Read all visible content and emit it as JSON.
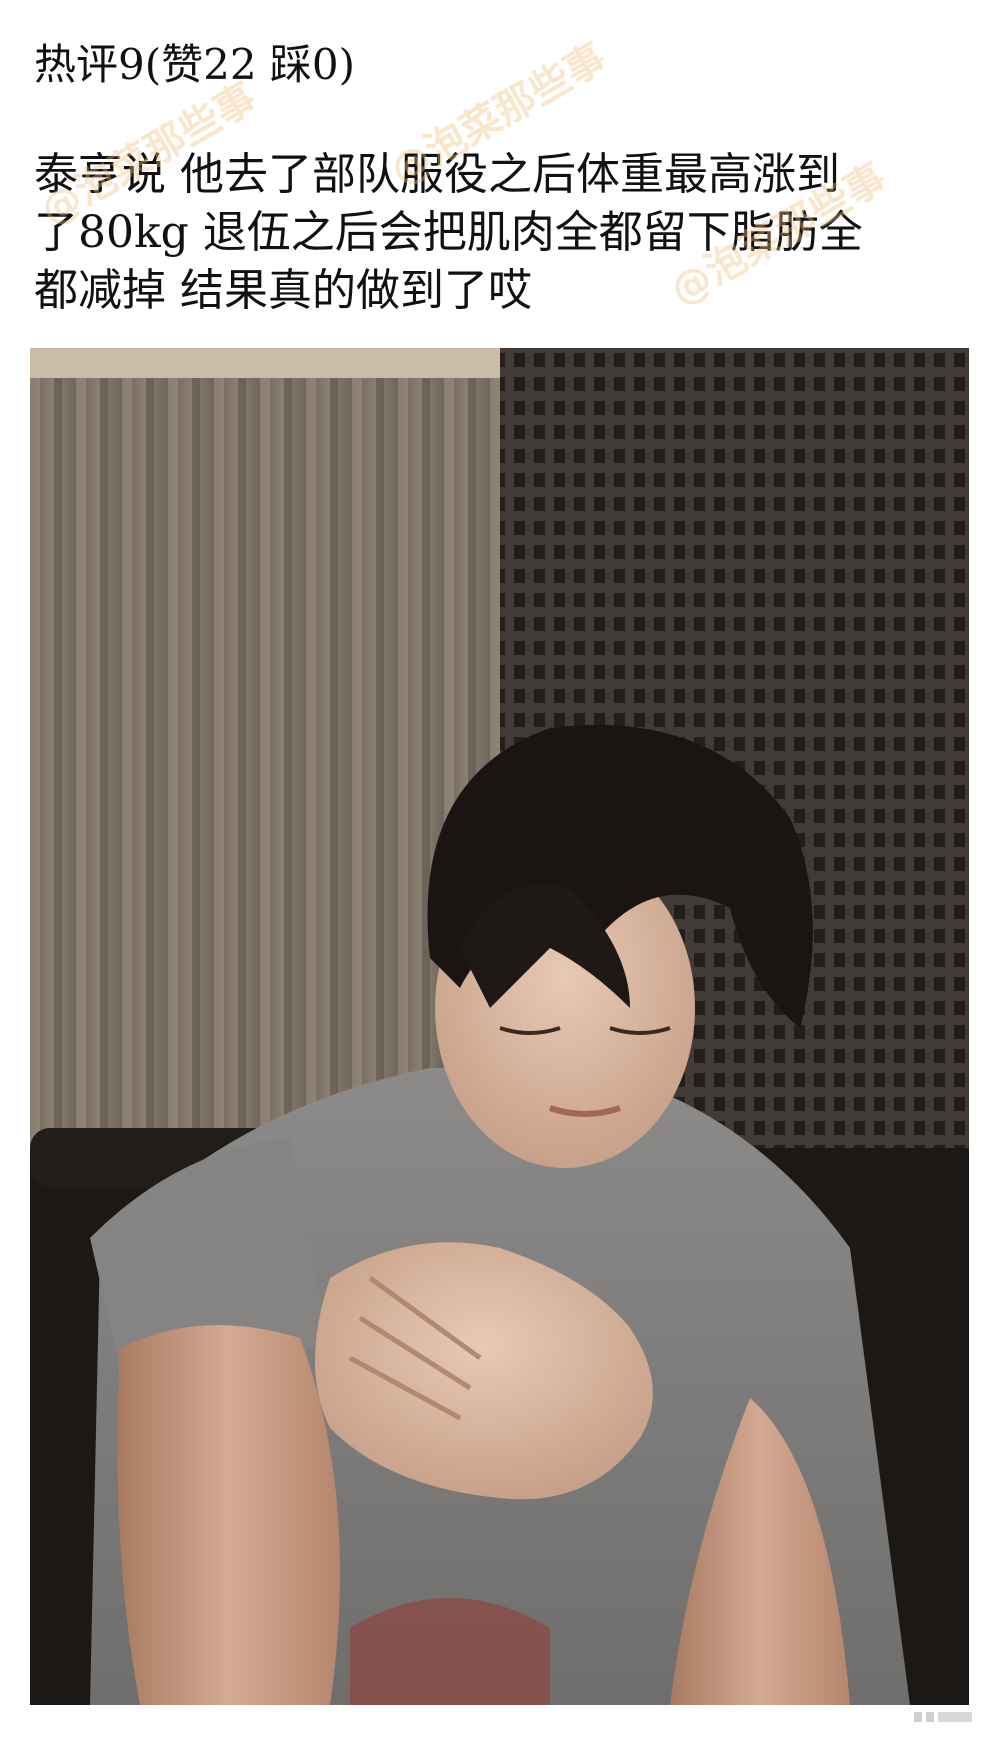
{
  "comment": {
    "header": "热评9(赞22 踩0)",
    "lines": [
      "泰亨说 他去了部队服役之后体重最高涨到",
      "了80kg 退伍之后会把肌肉全都留下脂肪全",
      "都减掉 结果真的做到了哎"
    ]
  },
  "watermark": {
    "text": "@泡菜那些事"
  },
  "photo": {
    "subject": "man in grey t-shirt with hand on chest in front of curtains"
  },
  "colors": {
    "background": "#ffffff",
    "text": "#111111",
    "watermark": "#f0be78"
  }
}
